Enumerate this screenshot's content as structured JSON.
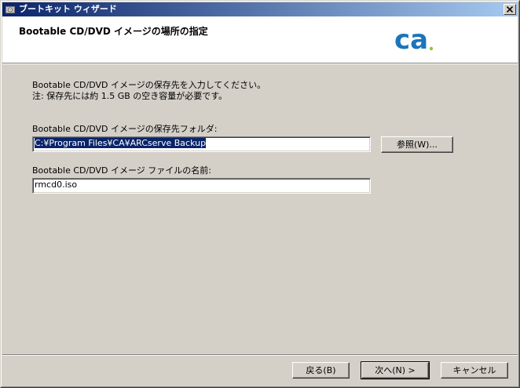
{
  "window": {
    "title": "ブートキット ウィザード",
    "close_glyph": "×"
  },
  "header": {
    "title": "Bootable CD/DVD イメージの場所の指定",
    "logo_text": "ca",
    "logo_color": "#1b75bb",
    "logo_accent": "#8dc63f"
  },
  "body": {
    "instruction_line1": "Bootable CD/DVD イメージの保存先を入力してください。",
    "instruction_line2": "注: 保存先には約 1.5 GB の空き容量が必要です。",
    "folder_label": "Bootable CD/DVD イメージの保存先フォルダ:",
    "folder_value": "C:¥Program Files¥CA¥ARCserve Backup",
    "browse_button": "参照(W)...",
    "filename_label": "Bootable CD/DVD イメージ ファイルの名前:",
    "filename_value": "rmcd0.iso"
  },
  "footer": {
    "back_button": "戻る(B)",
    "next_button": "次へ(N) >",
    "cancel_button": "キャンセル"
  }
}
